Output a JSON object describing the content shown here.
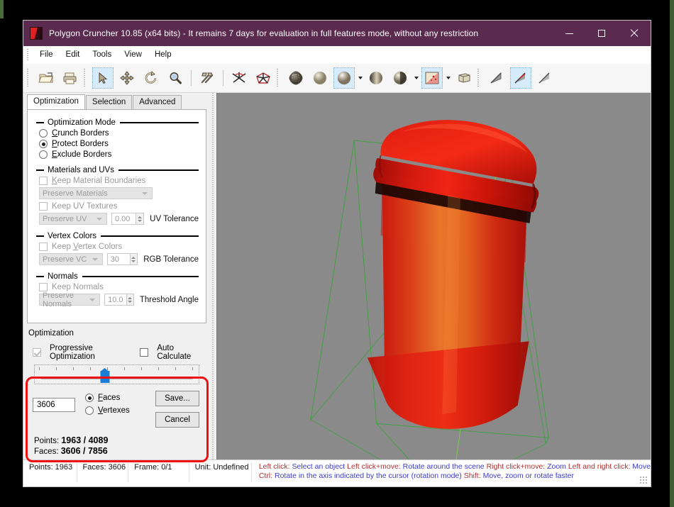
{
  "window": {
    "title": "Polygon Cruncher 10.85 (x64 bits) - It remains 7 days for evaluation in full features mode, without any restriction",
    "titlebar_color": "#5b2a4f",
    "minimize_label": "Minimize",
    "maximize_label": "Maximize",
    "close_label": "Close"
  },
  "menu": {
    "items": [
      {
        "label": "File"
      },
      {
        "label": "Edit"
      },
      {
        "label": "Tools"
      },
      {
        "label": "View"
      },
      {
        "label": "Help"
      }
    ]
  },
  "toolbar": {
    "groups": [
      {
        "buttons": [
          {
            "icon": "open-folder-icon",
            "active": false
          },
          {
            "icon": "print-icon",
            "active": false
          }
        ]
      },
      {
        "buttons": [
          {
            "icon": "select-arrow-icon",
            "active": true
          },
          {
            "icon": "move-icon",
            "active": false
          },
          {
            "icon": "rotate-icon",
            "active": false
          },
          {
            "icon": "zoom-magnifier-icon",
            "active": false
          }
        ]
      },
      {
        "buttons": [
          {
            "icon": "hammer-tools-icon",
            "active": false
          }
        ]
      },
      {
        "buttons": [
          {
            "icon": "normals-flip-icon",
            "active": false
          },
          {
            "icon": "wireframe-star-icon",
            "active": false
          }
        ]
      },
      {
        "buttons": [
          {
            "icon": "shading-wireframe-sphere-icon",
            "active": false
          },
          {
            "icon": "shading-flat-sphere-icon",
            "active": false
          },
          {
            "icon": "shading-smooth-sphere-icon",
            "active": true,
            "has_caret": true
          },
          {
            "icon": "shading-grid-sphere-icon",
            "active": false
          },
          {
            "icon": "shading-half-sphere-icon",
            "active": false,
            "has_caret": true
          },
          {
            "icon": "texture-swatch-icon",
            "active": true,
            "has_caret": true
          },
          {
            "icon": "lightbox-icon",
            "active": false
          }
        ]
      },
      {
        "buttons": [
          {
            "icon": "normal-arrow-gray-icon",
            "active": false
          },
          {
            "icon": "normal-arrow-red-icon",
            "active": true
          },
          {
            "icon": "normal-arrow-plain-icon",
            "active": false
          }
        ]
      }
    ]
  },
  "panel": {
    "tabs": [
      {
        "label": "Optimization",
        "active": true
      },
      {
        "label": "Selection",
        "active": false
      },
      {
        "label": "Advanced",
        "active": false
      }
    ],
    "groups": {
      "optimization_mode": {
        "title": "Optimization Mode",
        "options": [
          {
            "label": "Crunch Borders",
            "accel": "C",
            "selected": false
          },
          {
            "label": "Protect Borders",
            "accel": "P",
            "selected": true
          },
          {
            "label": "Exclude Borders",
            "accel": "E",
            "selected": false
          }
        ]
      },
      "materials_uvs": {
        "title": "Materials and UVs",
        "keep_material_boundaries": {
          "label": "Keep Material Boundaries",
          "accel": "K",
          "checked": false,
          "disabled": true
        },
        "materials_combo": {
          "value": "Preserve Materials",
          "disabled": true
        },
        "keep_uv_textures": {
          "label": "Keep UV Textures",
          "checked": false,
          "disabled": true
        },
        "uv_combo": {
          "value": "Preserve UV",
          "disabled": true
        },
        "uv_tolerance": {
          "value": "0.00",
          "label": "UV Tolerance",
          "disabled": true
        }
      },
      "vertex_colors": {
        "title": "Vertex Colors",
        "keep_vertex_colors": {
          "label": "Keep Vertex Colors",
          "accel": "V",
          "checked": false,
          "disabled": true
        },
        "vc_combo": {
          "value": "Preserve VC",
          "disabled": true
        },
        "rgb_tolerance": {
          "value": "30",
          "label": "RGB Tolerance",
          "disabled": true
        }
      },
      "normals": {
        "title": "Normals",
        "keep_normals": {
          "label": "Keep Normals",
          "checked": false,
          "disabled": true
        },
        "normals_combo": {
          "value": "Preserve Normals",
          "disabled": true
        },
        "threshold_angle": {
          "value": "10.0",
          "label": "Threshold Angle",
          "disabled": true
        }
      },
      "optimization": {
        "title": "Optimization",
        "progressive_optimization": {
          "label": "Progressive Optimization",
          "checked": true,
          "disabled": true
        },
        "auto_calculate": {
          "label": "Auto Calculate",
          "checked": false,
          "disabled": false
        },
        "slider": {
          "value_percent": 43
        },
        "count_value": "3606",
        "unit_options": [
          {
            "label": "Faces",
            "accel": "F",
            "selected": true
          },
          {
            "label": "Vertexes",
            "accel": "V",
            "selected": false
          }
        ],
        "save_label": "Save...",
        "cancel_label": "Cancel",
        "stats": [
          {
            "prefix": "Points: ",
            "value": "1963 / 4089"
          },
          {
            "prefix": "Faces: ",
            "value": "3606 / 7856"
          }
        ]
      }
    },
    "highlight_color": "#f01010"
  },
  "viewport": {
    "background_color": "#8a8a8a",
    "bounding_box_color": "#3fa03f",
    "model_name": "coffee-cup",
    "model_colors": {
      "lid": "#d81010",
      "body_top": "#e8712a",
      "body_bottom": "#cf1510"
    }
  },
  "statusbar": {
    "cells": [
      {
        "label": "Points: 1963"
      },
      {
        "label": "Faces: 3606"
      },
      {
        "label": "Frame: 0/1"
      },
      {
        "label": "Unit: Undefined"
      }
    ],
    "hints_line1": [
      {
        "key": "Left click:",
        "value": "Select an object"
      },
      {
        "key": "Left click+move:",
        "value": "Rotate around the scene"
      },
      {
        "key": "Right click+move:",
        "value": "Zoom"
      },
      {
        "key": "Left and right click:",
        "value": "Move"
      }
    ],
    "hints_line2": [
      {
        "key": "Ctrl:",
        "value": "Rotate in the axis indicated by the cursor (rotation mode)"
      },
      {
        "key": "Shift:",
        "value": "Move, zoom or rotate faster"
      }
    ]
  }
}
